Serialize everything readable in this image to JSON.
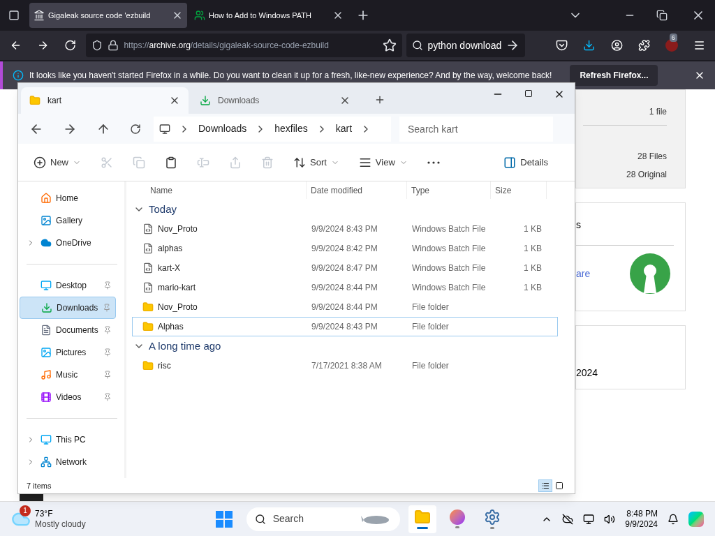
{
  "browser": {
    "tabs": [
      {
        "title": "Gigaleak source code 'ezbuild",
        "selected": true,
        "kind": "archive"
      },
      {
        "title": "How to Add to Windows PATH",
        "selected": false,
        "kind": "person"
      }
    ],
    "url": {
      "scheme": "https://",
      "host": "archive.org",
      "path": "/details/gigaleak-source-code-ezbuild"
    },
    "search": "python download",
    "extension_badge": "6",
    "notification": {
      "text": "It looks like you haven't started Firefox in a while. Do you want to clean it up for a fresh, like-new experience? And by the way, welcome back!",
      "button": "Refresh Firefox..."
    }
  },
  "page": {
    "files_card": {
      "count": "1 file",
      "files": "28 Files",
      "original": "28 Original"
    },
    "license_card": {
      "cut_word": "s",
      "link": "are"
    },
    "date_card": {
      "date": "2024"
    },
    "has_avatar": true
  },
  "explorer": {
    "tabs": [
      {
        "label": "kart",
        "selected": true,
        "kind": "folder"
      },
      {
        "label": "Downloads",
        "selected": false,
        "kind": "download"
      }
    ],
    "breadcrumb": [
      "Downloads",
      "hexfiles",
      "kart"
    ],
    "search_placeholder": "Search kart",
    "toolbar": [
      {
        "kind": "new",
        "label": "New",
        "disabled": false
      },
      {
        "kind": "cut",
        "disabled": true
      },
      {
        "kind": "copy",
        "disabled": true
      },
      {
        "kind": "paste",
        "disabled": false
      },
      {
        "kind": "rename",
        "disabled": true
      },
      {
        "kind": "share",
        "disabled": true
      },
      {
        "kind": "delete",
        "disabled": true
      },
      {
        "kind": "sort",
        "label": "Sort",
        "disabled": false
      },
      {
        "kind": "view",
        "label": "View",
        "disabled": false
      },
      {
        "kind": "more",
        "disabled": false
      },
      {
        "kind": "details",
        "label": "Details",
        "disabled": false
      }
    ],
    "sidebar": [
      [
        {
          "label": "Home",
          "kind": "home",
          "selected": false,
          "pinned": false
        },
        {
          "label": "Gallery",
          "kind": "gallery",
          "selected": false,
          "pinned": false
        },
        {
          "label": "OneDrive",
          "kind": "cloud",
          "selected": false,
          "pinned": false,
          "expanded": false
        }
      ],
      [
        {
          "label": "Desktop",
          "kind": "desktop",
          "selected": false,
          "pinned": true
        },
        {
          "label": "Downloads",
          "kind": "download",
          "selected": true,
          "pinned": true
        },
        {
          "label": "Documents",
          "kind": "documents",
          "selected": false,
          "pinned": true
        },
        {
          "label": "Pictures",
          "kind": "pictures",
          "selected": false,
          "pinned": true
        },
        {
          "label": "Music",
          "kind": "music",
          "selected": false,
          "pinned": true
        },
        {
          "label": "Videos",
          "kind": "videos",
          "selected": false,
          "pinned": true
        }
      ],
      [
        {
          "label": "This PC",
          "kind": "pc",
          "selected": false,
          "pinned": false,
          "expanded": false
        },
        {
          "label": "Network",
          "kind": "network",
          "selected": false,
          "pinned": false,
          "expanded": false
        }
      ]
    ],
    "columns": [
      "Name",
      "Date modified",
      "Type",
      "Size"
    ],
    "groups": [
      {
        "label": "Today",
        "expanded": true,
        "rows": [
          {
            "name": "Nov_Proto",
            "date": "9/9/2024 8:43 PM",
            "type": "Windows Batch File",
            "size": "1 KB",
            "kind": "batch",
            "focused": false
          },
          {
            "name": "alphas",
            "date": "9/9/2024 8:42 PM",
            "type": "Windows Batch File",
            "size": "1 KB",
            "kind": "batch",
            "focused": false
          },
          {
            "name": "kart-X",
            "date": "9/9/2024 8:47 PM",
            "type": "Windows Batch File",
            "size": "1 KB",
            "kind": "batch",
            "focused": false
          },
          {
            "name": "mario-kart",
            "date": "9/9/2024 8:44 PM",
            "type": "Windows Batch File",
            "size": "1 KB",
            "kind": "batch",
            "focused": false
          },
          {
            "name": "Nov_Proto",
            "date": "9/9/2024 8:44 PM",
            "type": "File folder",
            "kind": "folder",
            "focused": false
          },
          {
            "name": "Alphas",
            "date": "9/9/2024 8:43 PM",
            "type": "File folder",
            "kind": "folder",
            "focused": true
          }
        ]
      },
      {
        "label": "A long time ago",
        "expanded": true,
        "rows": [
          {
            "name": "risc",
            "date": "7/17/2021 8:38 AM",
            "type": "File folder",
            "kind": "folder",
            "focused": false
          }
        ]
      }
    ],
    "status": "7 items",
    "views": [
      {
        "kind": "details",
        "selected": true
      },
      {
        "kind": "tiles",
        "selected": false
      }
    ]
  },
  "taskbar": {
    "weather": {
      "badge": "1",
      "temp": "73°F",
      "desc": "Mostly cloudy"
    },
    "search_placeholder": "Search",
    "apps": [
      {
        "kind": "explorer",
        "selected": true
      },
      {
        "kind": "firefox",
        "selected": false
      },
      {
        "kind": "settings",
        "selected": false
      }
    ],
    "time": "8:48 PM",
    "date": "9/9/2024"
  }
}
